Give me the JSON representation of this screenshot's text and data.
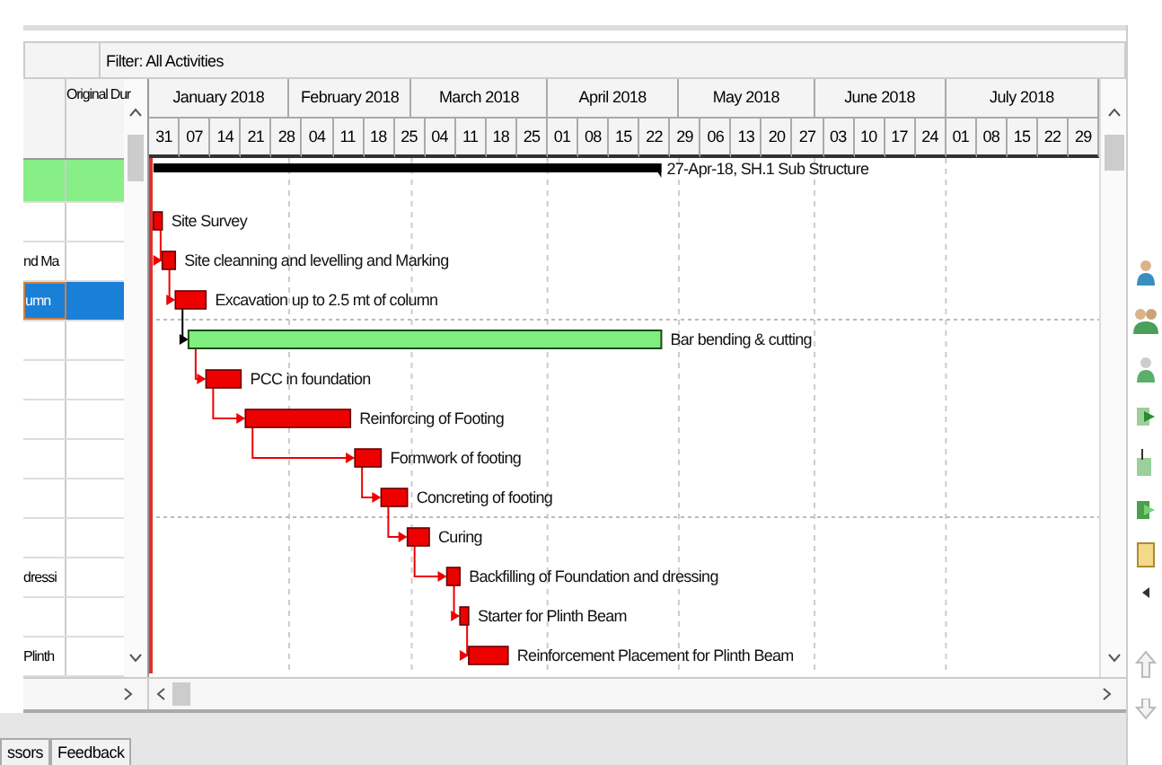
{
  "filter": "Filter: All Activities",
  "table": {
    "heading": "Original Dur"
  },
  "timescale": {
    "months": [
      "January 2018",
      "February 2018",
      "March 2018",
      "April 2018",
      "May 2018",
      "June 2018",
      "July 2018"
    ],
    "weeks": [
      "31",
      "07",
      "14",
      "21",
      "28",
      "04",
      "11",
      "18",
      "25",
      "04",
      "11",
      "18",
      "25",
      "01",
      "08",
      "15",
      "22",
      "29",
      "06",
      "13",
      "20",
      "27",
      "03",
      "10",
      "17",
      "24",
      "01",
      "08",
      "15",
      "22",
      "29"
    ]
  },
  "activities": [
    {
      "kind": "summary",
      "label": "27-Apr-18, SH.1  Sub Structure",
      "selected": false
    },
    {
      "kind": "critical",
      "label": "Site Survey",
      "selected": false
    },
    {
      "kind": "critical",
      "column_1": "nd Ma",
      "label": "Site cleanning and levelling and Marking",
      "selected": false
    },
    {
      "kind": "critical",
      "column_1": "umn",
      "label": "Excavation up to 2.5 mt of column",
      "selected": true
    },
    {
      "kind": "normal",
      "label": "Bar bending & cutting",
      "selected": false
    },
    {
      "kind": "critical",
      "label": "PCC in foundation",
      "selected": false
    },
    {
      "kind": "critical",
      "label": "Reinforcing of Footing",
      "selected": false
    },
    {
      "kind": "critical",
      "label": "Formwork of footing",
      "selected": false
    },
    {
      "kind": "critical",
      "label": "Concreting of footing",
      "selected": false
    },
    {
      "kind": "critical",
      "label": "Curing",
      "selected": false
    },
    {
      "kind": "critical",
      "column_1": "dressi",
      "label": "Backfilling of Foundation and dressing",
      "selected": false
    },
    {
      "kind": "critical",
      "label": "Starter for Plinth Beam",
      "selected": false
    },
    {
      "kind": "critical",
      "column_1": "Plinth",
      "label": "Reinforcement Placement for Plinth Beam",
      "selected": false
    }
  ],
  "bottom_tabs": [
    "ssors",
    "Feedback"
  ]
}
